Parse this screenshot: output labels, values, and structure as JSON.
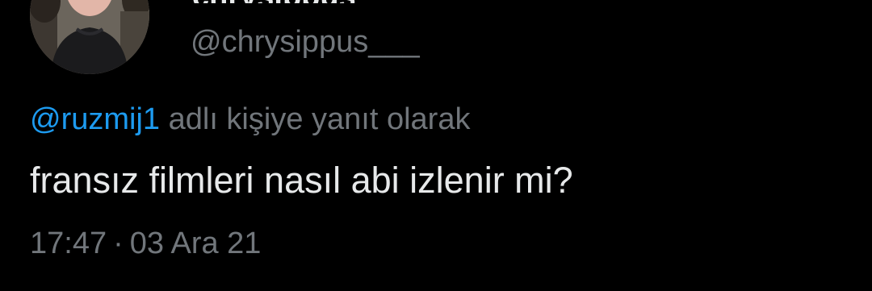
{
  "tweet": {
    "author": {
      "display_name": "chrysippus",
      "handle": "@chrysippus___"
    },
    "reply_to": {
      "mention": "@ruzmij1",
      "text": "adlı kişiye yanıt olarak"
    },
    "text": "fransız filmleri nasıl abi izlenir mi?",
    "time": "17:47",
    "separator": "·",
    "date": "03 Ara 21"
  },
  "colors": {
    "background": "#000000",
    "primary_text": "#e7e9ea",
    "secondary_text": "#71767b",
    "link": "#1d9bf0"
  }
}
